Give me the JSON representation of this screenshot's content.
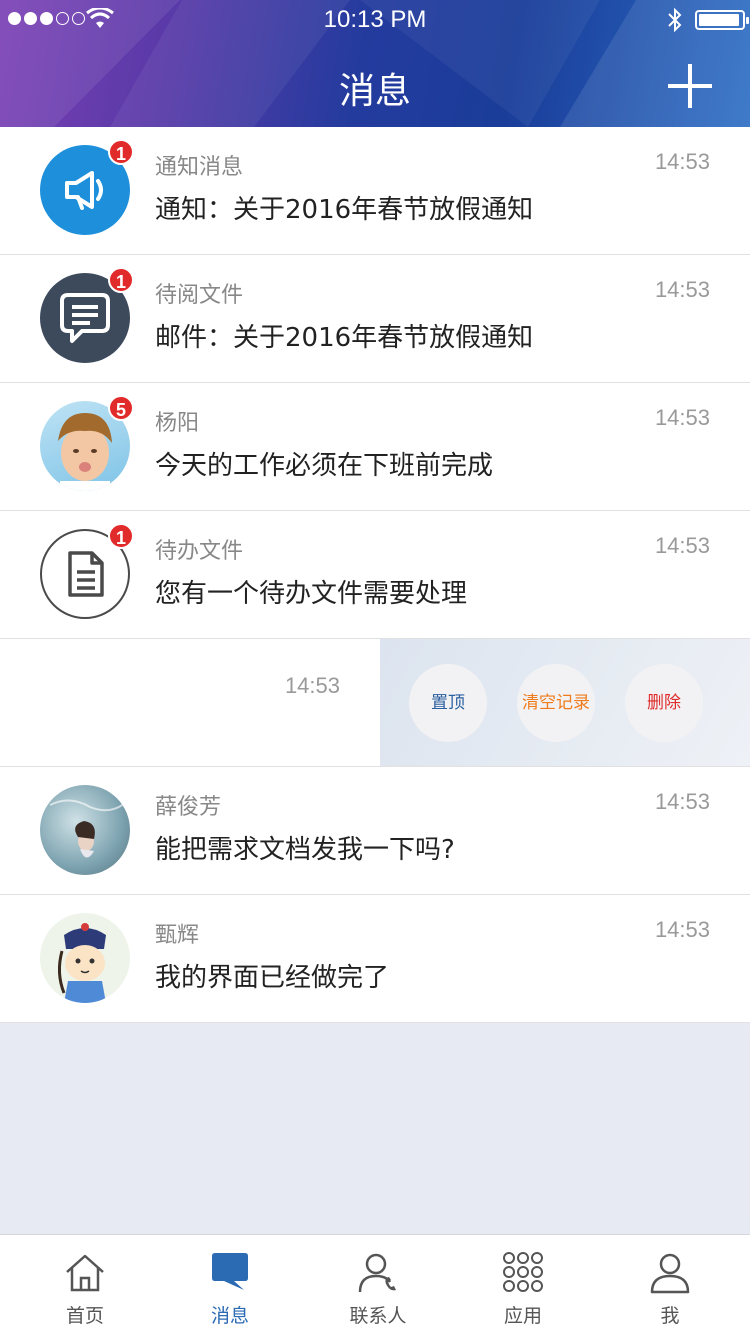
{
  "status_bar": {
    "time": "10:13 PM"
  },
  "header": {
    "title": "消息"
  },
  "messages": [
    {
      "name": "通知消息",
      "text": "通知：关于2016年春节放假通知",
      "time": "14:53",
      "badge": "1"
    },
    {
      "name": "待阅文件",
      "text": "邮件：关于2016年春节放假通知",
      "time": "14:53",
      "badge": "1"
    },
    {
      "name": "杨阳",
      "text": "今天的工作必须在下班前完成",
      "time": "14:53",
      "badge": "5"
    },
    {
      "name": "待办文件",
      "text": "您有一个待办文件需要处理",
      "time": "14:53",
      "badge": "1"
    },
    {
      "time": "14:53"
    },
    {
      "name": "薛俊芳",
      "text": "能把需求文档发我一下吗?",
      "time": "14:53"
    },
    {
      "name": "甄辉",
      "text": "我的界面已经做完了",
      "time": "14:53"
    }
  ],
  "swipe_actions": {
    "pin": "置顶",
    "clear": "清空记录",
    "delete": "删除",
    "colors": {
      "pin": "#2a5fa0",
      "clear": "#f07b1c",
      "delete": "#e02a2a"
    }
  },
  "tabs": [
    {
      "label": "首页",
      "icon": "home-icon"
    },
    {
      "label": "消息",
      "icon": "chat-bubble-icon",
      "active": true
    },
    {
      "label": "联系人",
      "icon": "contact-icon"
    },
    {
      "label": "应用",
      "icon": "apps-grid-icon"
    },
    {
      "label": "我",
      "icon": "user-icon"
    }
  ],
  "colors": {
    "accent": "#2a6bb3",
    "badge": "#e12b2b",
    "notice_icon_bg": "#1e90db",
    "doc_icon_bg": "#3d4a5c"
  }
}
